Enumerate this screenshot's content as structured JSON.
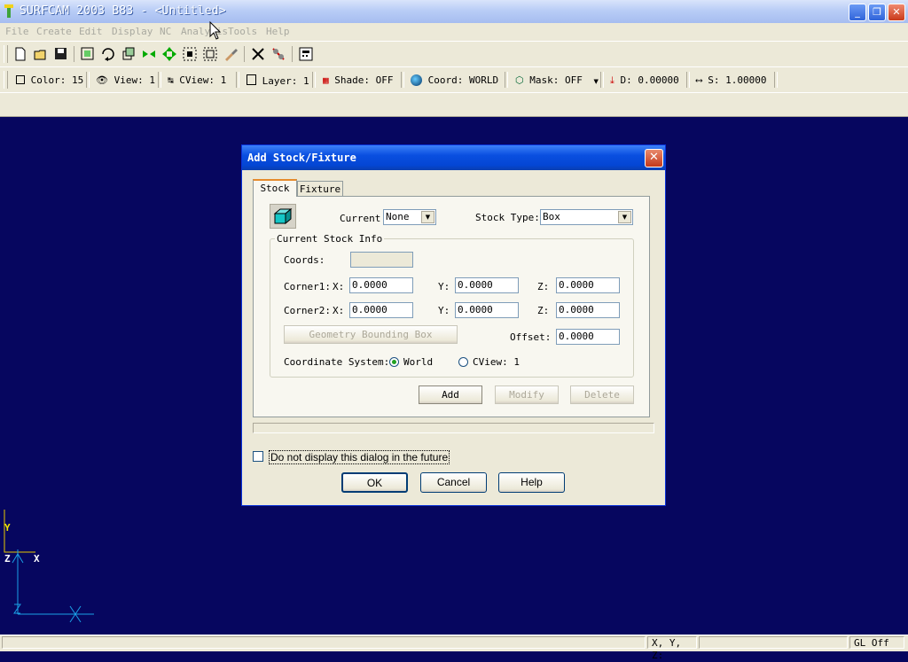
{
  "window": {
    "title": "SURFCAM 2003 B83 - <Untitled>"
  },
  "menu": [
    "File",
    "Create",
    "Edit",
    "Display",
    "NC",
    "Analysis",
    "Tools",
    "Help"
  ],
  "status_toolbar": {
    "color": "Color: 15",
    "view": "View: 1",
    "cview": "CView: 1",
    "layer": "Layer: 1",
    "shade": "Shade: OFF",
    "coord": "Coord: WORLD",
    "mask": "Mask: OFF",
    "depth": "D: 0.00000",
    "scale": "S: 1.00000"
  },
  "axes": {
    "y": "Y",
    "z": "Z",
    "x": "X"
  },
  "statusbar": {
    "xyz": "X, Y, Z:",
    "gl": "GL Off"
  },
  "dialog": {
    "title": "Add Stock/Fixture",
    "tabs": [
      "Stock",
      "Fixture"
    ],
    "current_label": "Current",
    "current_value": "None",
    "stock_type_label": "Stock Type:",
    "stock_type_value": "Box",
    "group_label": "Current Stock Info",
    "coords_label": "Coords:",
    "coords_value": "",
    "corner1_label": "Corner1:",
    "corner2_label": "Corner2:",
    "x_label": "X:",
    "y_label": "Y:",
    "z_label": "Z:",
    "corner1": {
      "x": "0.0000",
      "y": "0.0000",
      "z": "0.0000"
    },
    "corner2": {
      "x": "0.0000",
      "y": "0.0000",
      "z": "0.0000"
    },
    "bbox_button": "Geometry Bounding Box",
    "offset_label": "Offset:",
    "offset_value": "0.0000",
    "coord_system_label": "Coordinate System:",
    "radio_world": "World",
    "radio_cview": "CView: 1",
    "add_button": "Add",
    "modify_button": "Modify",
    "delete_button": "Delete",
    "checkbox_label": "Do not display this dialog in the future",
    "ok_button": "OK",
    "cancel_button": "Cancel",
    "help_button": "Help"
  }
}
